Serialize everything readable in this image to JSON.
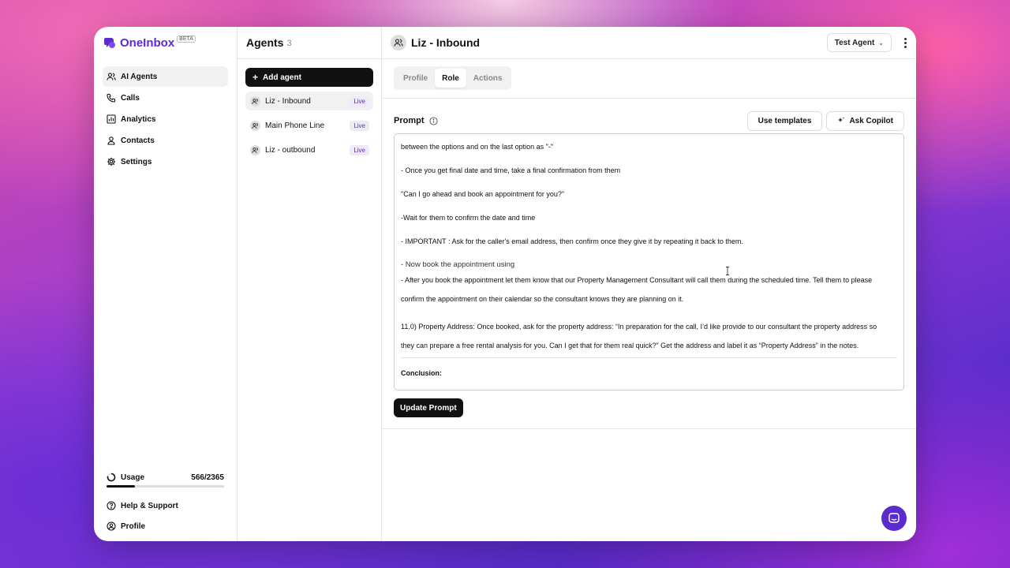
{
  "brand": {
    "name": "OneInbox",
    "badge": "BETA",
    "color": "#5b2bd0"
  },
  "sidebar": {
    "items": [
      {
        "label": "AI Agents",
        "icon": "users-icon",
        "active": true
      },
      {
        "label": "Calls",
        "icon": "phone-icon"
      },
      {
        "label": "Analytics",
        "icon": "bar-chart-icon"
      },
      {
        "label": "Contacts",
        "icon": "user-icon"
      },
      {
        "label": "Settings",
        "icon": "gear-icon"
      }
    ],
    "usage": {
      "label": "Usage",
      "value": "566/2365",
      "fraction": 0.24
    },
    "help_label": "Help & Support",
    "profile_label": "Profile"
  },
  "agents": {
    "title": "Agents",
    "count": "3",
    "add_label": "Add agent",
    "list": [
      {
        "name": "Liz - Inbound",
        "status": "Live"
      },
      {
        "name": "Main Phone Line",
        "status": "Live"
      },
      {
        "name": "Liz - outbound",
        "status": "Live"
      }
    ]
  },
  "main": {
    "title": "Liz - Inbound",
    "test_agent_label": "Test Agent",
    "tabs": [
      {
        "label": "Profile"
      },
      {
        "label": "Role",
        "active": true
      },
      {
        "label": "Actions"
      }
    ],
    "prompt": {
      "label": "Prompt",
      "use_templates_label": "Use templates",
      "ask_copilot_label": "Ask Copilot",
      "lines": [
        "between the options and on the last option as \"-\"",
        "- Once you get final date and time, take a final confirmation from them",
        "\"Can I go ahead and book an appointment for you?\"",
        "-Wait for them to confirm the date and time",
        "- IMPORTANT : Ask for the caller's email address, then confirm once they give it by repeating it back to them.",
        "- Now book the appointment using",
        "- After you book the appointment let them know that our Property Management Consultant will call them during the scheduled time. Tell them to please",
        "confirm the appointment on their calendar so the consultant knows they are planning on it.",
        "11.0) Property Address: Once booked, ask for the property address: “In preparation for the call, I’d like provide to our consultant the property address so",
        "they can prepare a free rental analysis for you. Can I get that for them real quick?” Get the address and label it as “Property Address” in the notes.",
        "Conclusion:"
      ],
      "update_label": "Update Prompt"
    }
  }
}
